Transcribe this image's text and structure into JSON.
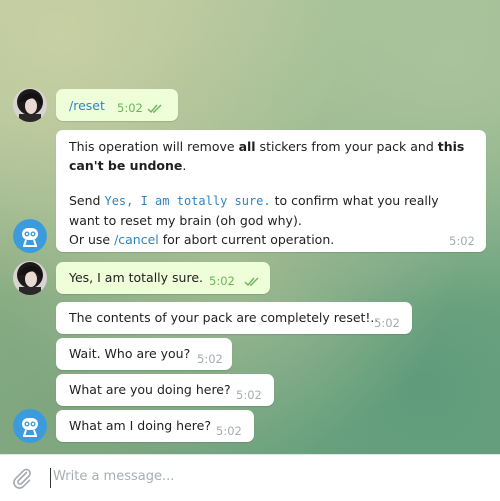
{
  "messages": {
    "reset_cmd": {
      "text": "/reset",
      "time": "5:02"
    },
    "bot_warning": {
      "line1_a": "This operation will remove ",
      "line1_b": "all",
      "line1_c": " stickers from your pack and ",
      "line1_d": "this",
      "line2": "can't be undone",
      "line2_end": ".",
      "line3_a": "Send ",
      "line3_code": "Yes, I am totally sure.",
      "line3_b": " to confirm what you really",
      "line4": "want to reset my brain (oh god why).",
      "line5_a": "Or use ",
      "line5_link": "/cancel",
      "line5_b": " for abort current operation.",
      "time": "5:02"
    },
    "user_confirm": {
      "text": "Yes, I am totally sure.",
      "time": "5:02"
    },
    "bot_reset": {
      "text": "The contents of your pack are completely reset!..",
      "time": "5:02"
    },
    "bot_who": {
      "text": "Wait. Who are you?",
      "time": "5:02"
    },
    "bot_what_doing": {
      "text": "What are you doing here?",
      "time": "5:02"
    },
    "bot_what_am_i": {
      "text": "What am I doing here?",
      "time": "5:02"
    }
  },
  "composer": {
    "placeholder": "Write a message..."
  },
  "icons": {
    "user_avatar": "user-avatar",
    "bot_avatar": "bot-avatar",
    "read_receipt": "double-check-icon",
    "attach": "paperclip-icon"
  },
  "colors": {
    "outgoing_bubble": "#eefed9",
    "incoming_bubble": "#ffffff",
    "link": "#2f84c2",
    "read_check": "#6cb35e",
    "bot_avatar": "#3b9bdc"
  }
}
